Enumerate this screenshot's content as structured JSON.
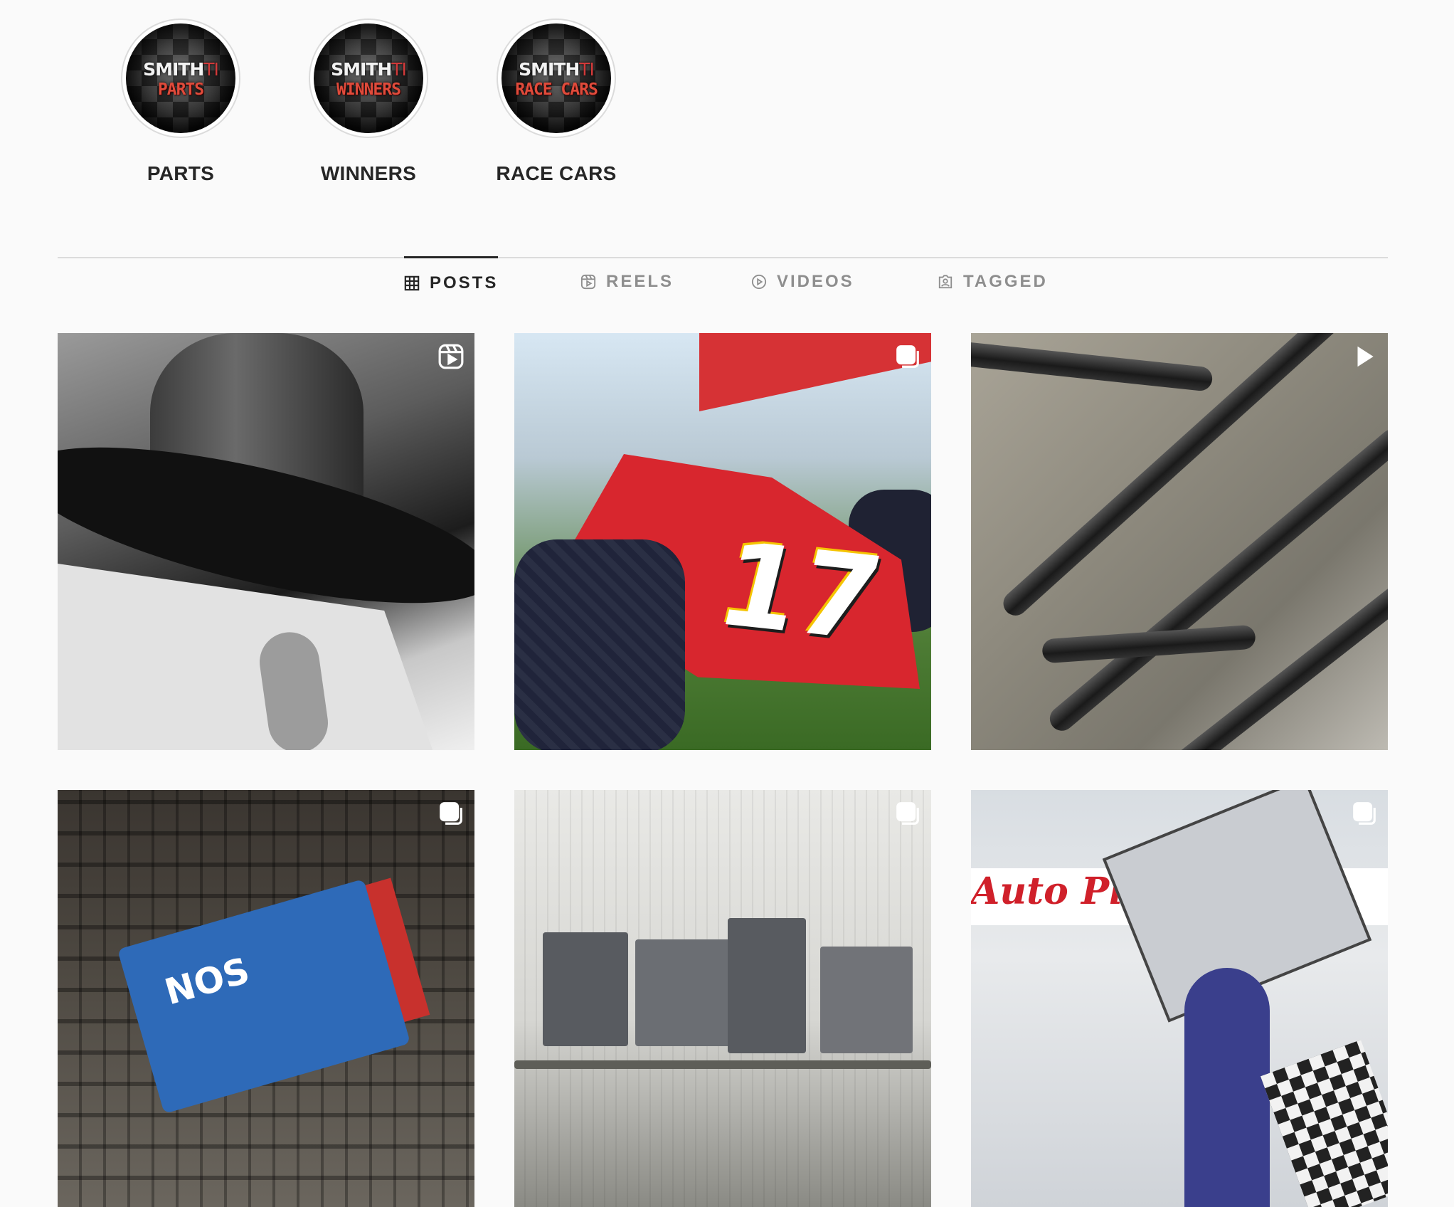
{
  "highlights": [
    {
      "label": "PARTS",
      "brand": "SMITH",
      "brand_suffix": "TI",
      "sub": "PARTS"
    },
    {
      "label": "WINNERS",
      "brand": "SMITH",
      "brand_suffix": "TI",
      "sub": "WINNERS"
    },
    {
      "label": "RACE CARS",
      "brand": "SMITH",
      "brand_suffix": "TI",
      "sub": "RACE CARS"
    }
  ],
  "tabs": [
    {
      "label": "POSTS",
      "icon": "grid-icon",
      "active": true
    },
    {
      "label": "REELS",
      "icon": "reels-icon",
      "active": false
    },
    {
      "label": "VIDEOS",
      "icon": "play-circle-icon",
      "active": false
    },
    {
      "label": "TAGGED",
      "icon": "tagged-person-icon",
      "active": false
    }
  ],
  "posts": [
    {
      "badge": "reel-icon"
    },
    {
      "badge": "carousel-icon",
      "car_number": "17"
    },
    {
      "badge": "video-play-icon"
    },
    {
      "badge": "carousel-icon",
      "sponsor": "NOS"
    },
    {
      "badge": "carousel-icon"
    },
    {
      "badge": "carousel-icon",
      "banner": "Auto Pla"
    }
  ],
  "colors": {
    "background": "#fafafa",
    "text_primary": "#262626",
    "text_muted": "#8e8e8e",
    "divider": "#dbdbdb"
  }
}
